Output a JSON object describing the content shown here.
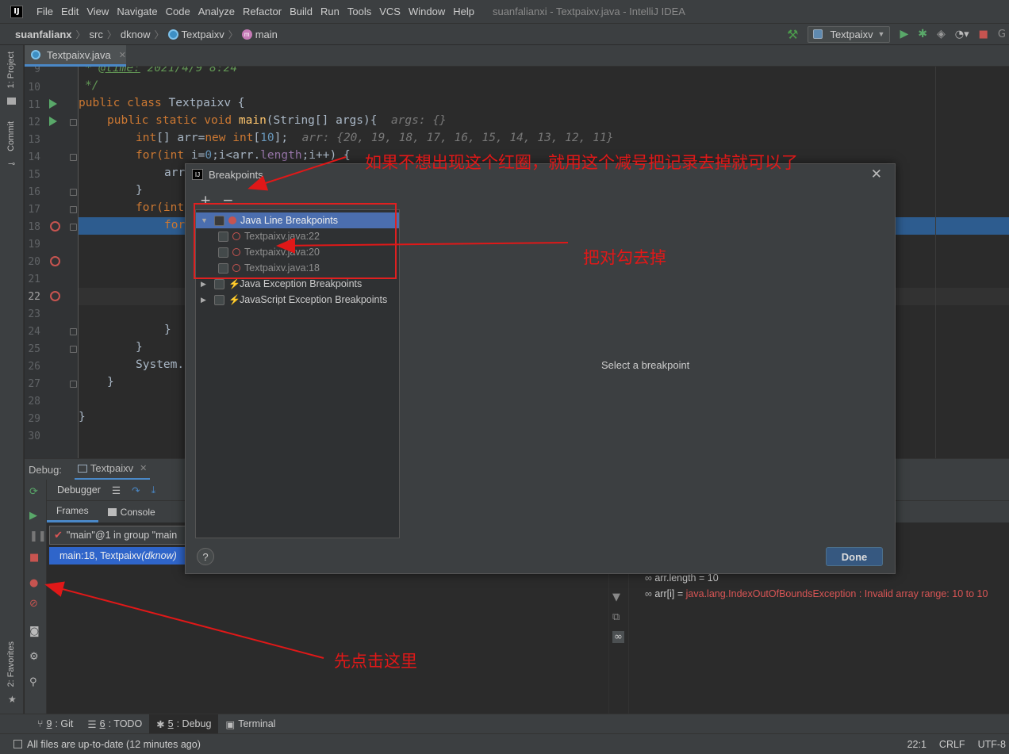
{
  "menubar": {
    "logo": "IJ",
    "items": [
      "File",
      "Edit",
      "View",
      "Navigate",
      "Code",
      "Analyze",
      "Refactor",
      "Build",
      "Run",
      "Tools",
      "VCS",
      "Window",
      "Help"
    ],
    "window_title": "suanfalianxi - Textpaixv.java - IntelliJ IDEA"
  },
  "breadcrumbs": [
    "suanfalianx",
    "src",
    "dknow",
    "Textpaixv",
    "main"
  ],
  "run_config": "Textpaixv",
  "left_strip": {
    "project": "1: Project",
    "commit": "Commit",
    "favorites": "2: Favorites"
  },
  "editor_tab": "Textpaixv.java",
  "line_numbers": [
    "9",
    "10",
    "11",
    "12",
    "13",
    "14",
    "15",
    "16",
    "17",
    "18",
    "19",
    "20",
    "21",
    "22",
    "23",
    "24",
    "25",
    "26",
    "27",
    "28",
    "29",
    "30"
  ],
  "code": {
    "l9_tag": "@time:",
    "l9_rest": " 2021/4/9 8:24",
    "l10": "*/",
    "l11_kw": "public class ",
    "l11_name": "Textpaixv",
    "l11_end": " {",
    "l12_kw": "public static void ",
    "l12_fn": "main",
    "l12_args": "(String[] args){",
    "l12_hint": "args: {}",
    "l13_kw": "int",
    "l13_a": "[] arr=",
    "l13_new": "new int",
    "l13_b": "[",
    "l13_num": "10",
    "l13_c": "];",
    "l13_hint": "arr: {20, 19, 18, 17, 16, 15, 14, 13, 12, 11}",
    "l14_for": "for(",
    "l14_int": "int",
    "l14_a": " i=",
    "l14_zero": "0",
    "l14_b": ";i<arr.",
    "l14_len": "length",
    "l14_c": ";i++) {",
    "l15": "arr",
    "l16": "}",
    "l17_for": "for(",
    "l17_int": "int",
    "l18": "for",
    "l24": "}",
    "l25": "}",
    "l26": "System.",
    "l27": "}",
    "l29": "}"
  },
  "debug": {
    "label": "Debug:",
    "tab": "Textpaixv",
    "debugger_tab": "Debugger",
    "frames_tab": "Frames",
    "console_tab": "Console",
    "thread": "\"main\"@1 in group \"main",
    "frame_main": "main:18, Textpaixv",
    "frame_pkg": " (dknow)",
    "var1_name": "arr.length",
    "var1_val": " = 10",
    "var2_name": "arr[i]",
    "var2_eq": " = ",
    "var2_val": "java.lang.IndexOutOfBoundsException : Invalid array range: 10 to 10"
  },
  "bottom_tabs": [
    {
      "num": "9",
      "label": ": Git"
    },
    {
      "num": "6",
      "label": ": TODO"
    },
    {
      "num": "5",
      "label": ": Debug"
    },
    {
      "num": "",
      "label": "Terminal"
    }
  ],
  "status": {
    "message": "All files are up-to-date (12 minutes ago)",
    "position": "22:1",
    "line_sep": "CRLF",
    "encoding": "UTF-8"
  },
  "dialog": {
    "title": "Breakpoints",
    "add": "+",
    "remove": "−",
    "tree": {
      "java_line": "Java Line Breakpoints",
      "bp1": "Textpaixv.java:22",
      "bp2": "Textpaixv.java:20",
      "bp3": "Textpaixv.java:18",
      "java_exception": "Java Exception Breakpoints",
      "js_exception": "JavaScript Exception Breakpoints"
    },
    "detail": "Select a breakpoint",
    "help": "?",
    "done": "Done"
  },
  "annotations": {
    "top": "如果不想出现这个红圈，就用这个减号把记录去掉就可以了",
    "middle": "把对勾去掉",
    "bottom": "先点击这里"
  },
  "colors": {
    "accent": "#4a88c7",
    "annotation": "#e01818",
    "breakpoint": "#c75450",
    "selection": "#2d5c8f"
  }
}
